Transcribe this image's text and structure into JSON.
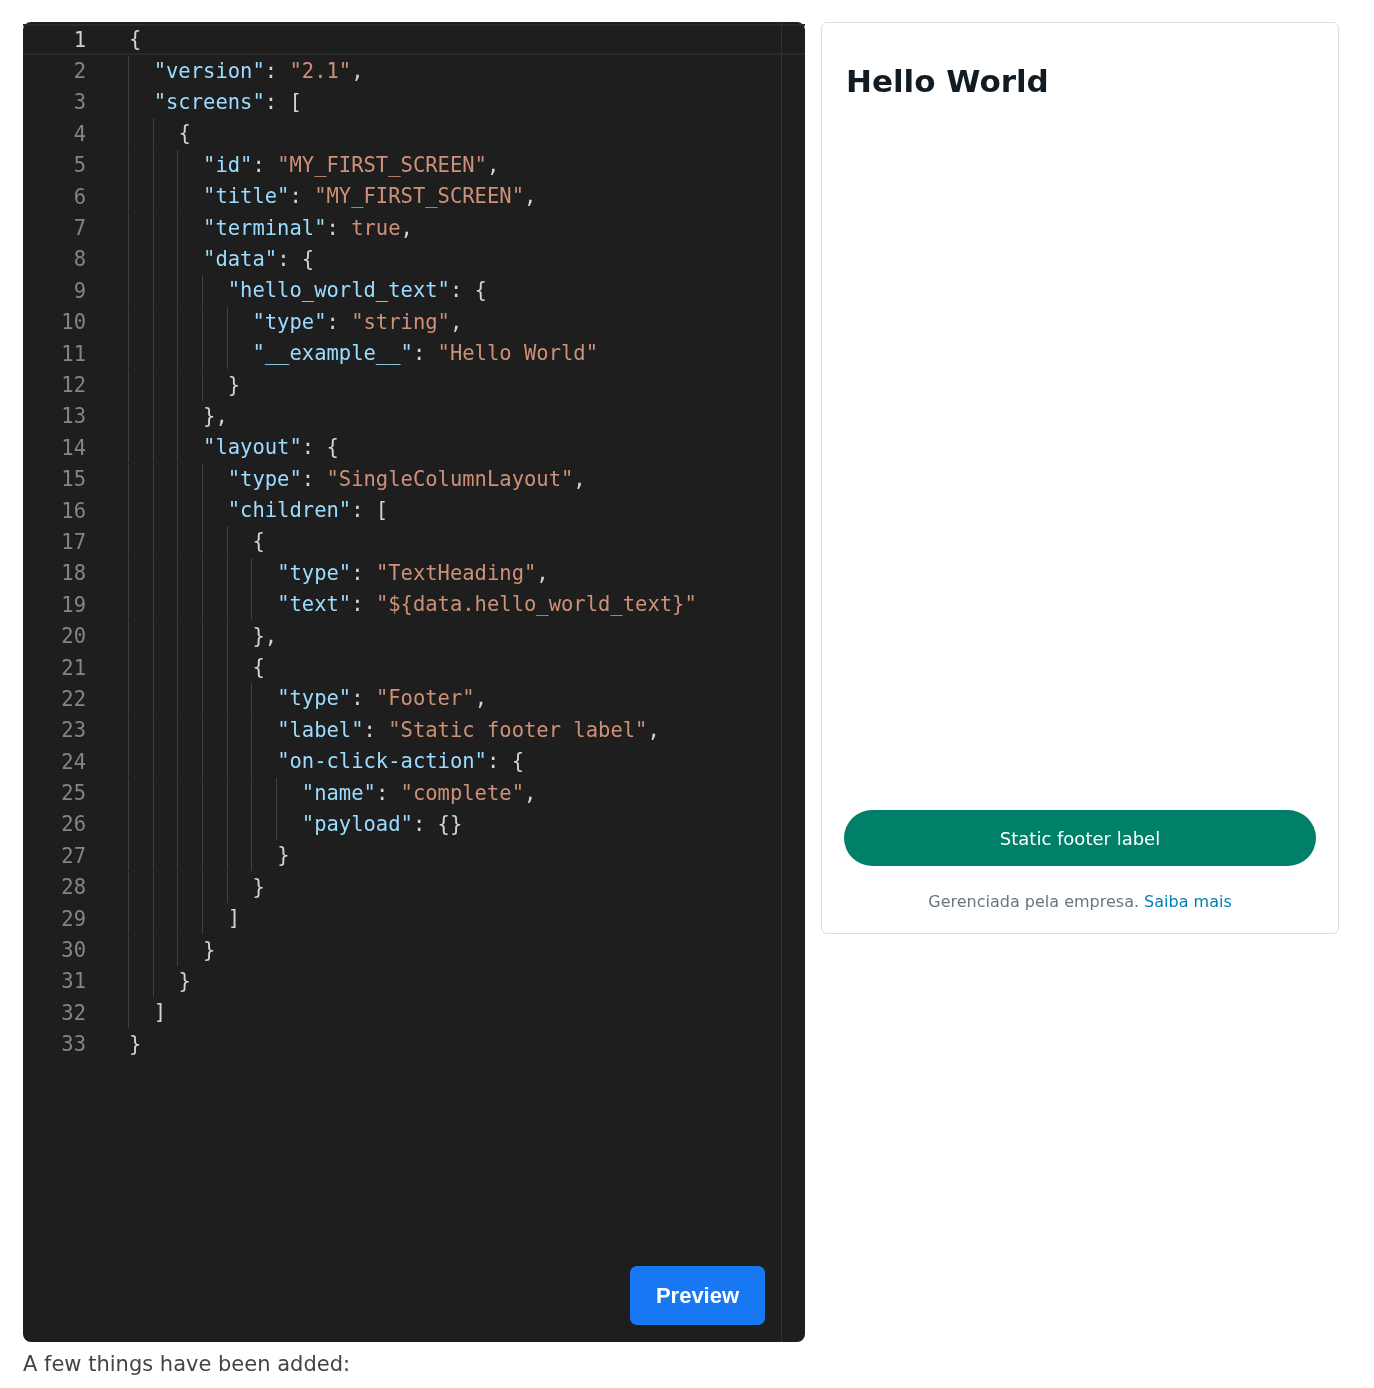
{
  "editor": {
    "lines": [
      {
        "number": "1",
        "text": "{",
        "current": true
      },
      {
        "number": "2",
        "text": "  \"version\": \"2.1\",",
        "current": false
      },
      {
        "number": "3",
        "text": "  \"screens\": [",
        "current": false
      },
      {
        "number": "4",
        "text": "    {",
        "current": false
      },
      {
        "number": "5",
        "text": "      \"id\": \"MY_FIRST_SCREEN\",",
        "current": false
      },
      {
        "number": "6",
        "text": "      \"title\": \"MY_FIRST_SCREEN\",",
        "current": false
      },
      {
        "number": "7",
        "text": "      \"terminal\": true,",
        "current": false
      },
      {
        "number": "8",
        "text": "      \"data\": {",
        "current": false
      },
      {
        "number": "9",
        "text": "        \"hello_world_text\": {",
        "current": false
      },
      {
        "number": "10",
        "text": "          \"type\": \"string\",",
        "current": false
      },
      {
        "number": "11",
        "text": "          \"__example__\": \"Hello World\"",
        "current": false
      },
      {
        "number": "12",
        "text": "        }",
        "current": false
      },
      {
        "number": "13",
        "text": "      },",
        "current": false
      },
      {
        "number": "14",
        "text": "      \"layout\": {",
        "current": false
      },
      {
        "number": "15",
        "text": "        \"type\": \"SingleColumnLayout\",",
        "current": false
      },
      {
        "number": "16",
        "text": "        \"children\": [",
        "current": false
      },
      {
        "number": "17",
        "text": "          {",
        "current": false
      },
      {
        "number": "18",
        "text": "            \"type\": \"TextHeading\",",
        "current": false
      },
      {
        "number": "19",
        "text": "            \"text\": \"${data.hello_world_text}\"",
        "current": false
      },
      {
        "number": "20",
        "text": "          },",
        "current": false
      },
      {
        "number": "21",
        "text": "          {",
        "current": false
      },
      {
        "number": "22",
        "text": "            \"type\": \"Footer\",",
        "current": false
      },
      {
        "number": "23",
        "text": "            \"label\": \"Static footer label\",",
        "current": false
      },
      {
        "number": "24",
        "text": "            \"on-click-action\": {",
        "current": false
      },
      {
        "number": "25",
        "text": "              \"name\": \"complete\",",
        "current": false
      },
      {
        "number": "26",
        "text": "              \"payload\": {}",
        "current": false
      },
      {
        "number": "27",
        "text": "            }",
        "current": false
      },
      {
        "number": "28",
        "text": "          }",
        "current": false
      },
      {
        "number": "29",
        "text": "        ]",
        "current": false
      },
      {
        "number": "30",
        "text": "      }",
        "current": false
      },
      {
        "number": "31",
        "text": "    }",
        "current": false
      },
      {
        "number": "32",
        "text": "  ]",
        "current": false
      },
      {
        "number": "33",
        "text": "}",
        "current": false
      }
    ],
    "preview_button": "Preview"
  },
  "preview": {
    "heading": "Hello World",
    "footer_button": "Static footer label",
    "caption": "Gerenciada pela empresa.",
    "caption_link": "Saiba mais"
  },
  "note": "A few things have been added:"
}
